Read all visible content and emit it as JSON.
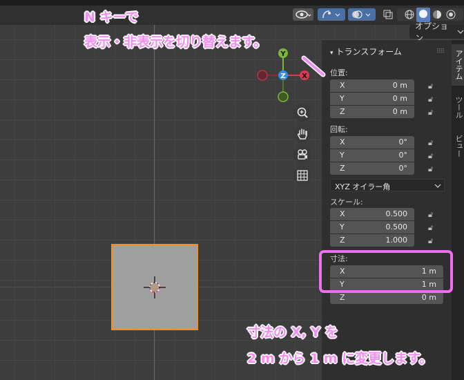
{
  "header": {
    "options_label": "オプション"
  },
  "annotation": {
    "top_line1": "N キーで",
    "top_line2": "表示・非表示を切り替えます。",
    "bottom_line1": "寸法の X, Y を",
    "bottom_line2": "2 m から 1 m に変更します。"
  },
  "gizmo": {
    "y": "Y",
    "z": "Z",
    "x": "X"
  },
  "tabs": {
    "item": "アイテム",
    "tool": "ツール",
    "view": "ビュー"
  },
  "panel": {
    "title": "トランスフォーム",
    "location": {
      "label": "位置:",
      "rows": [
        {
          "axis": "X",
          "value": "0 m"
        },
        {
          "axis": "Y",
          "value": "0 m"
        },
        {
          "axis": "Z",
          "value": "0 m"
        }
      ]
    },
    "rotation": {
      "label": "回転:",
      "rows": [
        {
          "axis": "X",
          "value": "0°"
        },
        {
          "axis": "Y",
          "value": "0°"
        },
        {
          "axis": "Z",
          "value": "0°"
        }
      ],
      "mode": "XYZ オイラー角"
    },
    "scale": {
      "label": "スケール:",
      "rows": [
        {
          "axis": "X",
          "value": "0.500"
        },
        {
          "axis": "Y",
          "value": "0.500"
        },
        {
          "axis": "Z",
          "value": "1.000"
        }
      ]
    },
    "dimensions": {
      "label": "寸法:",
      "rows": [
        {
          "axis": "X",
          "value": "1 m"
        },
        {
          "axis": "Y",
          "value": "1 m"
        },
        {
          "axis": "Z",
          "value": "0 m"
        }
      ]
    }
  },
  "colors": {
    "annotation": "#f58cf5",
    "highlight": "#f06ff0",
    "x_axis": "#e0384c",
    "y_axis": "#7cb832",
    "z_axis": "#2f8fe8",
    "selection": "#f0901e"
  }
}
